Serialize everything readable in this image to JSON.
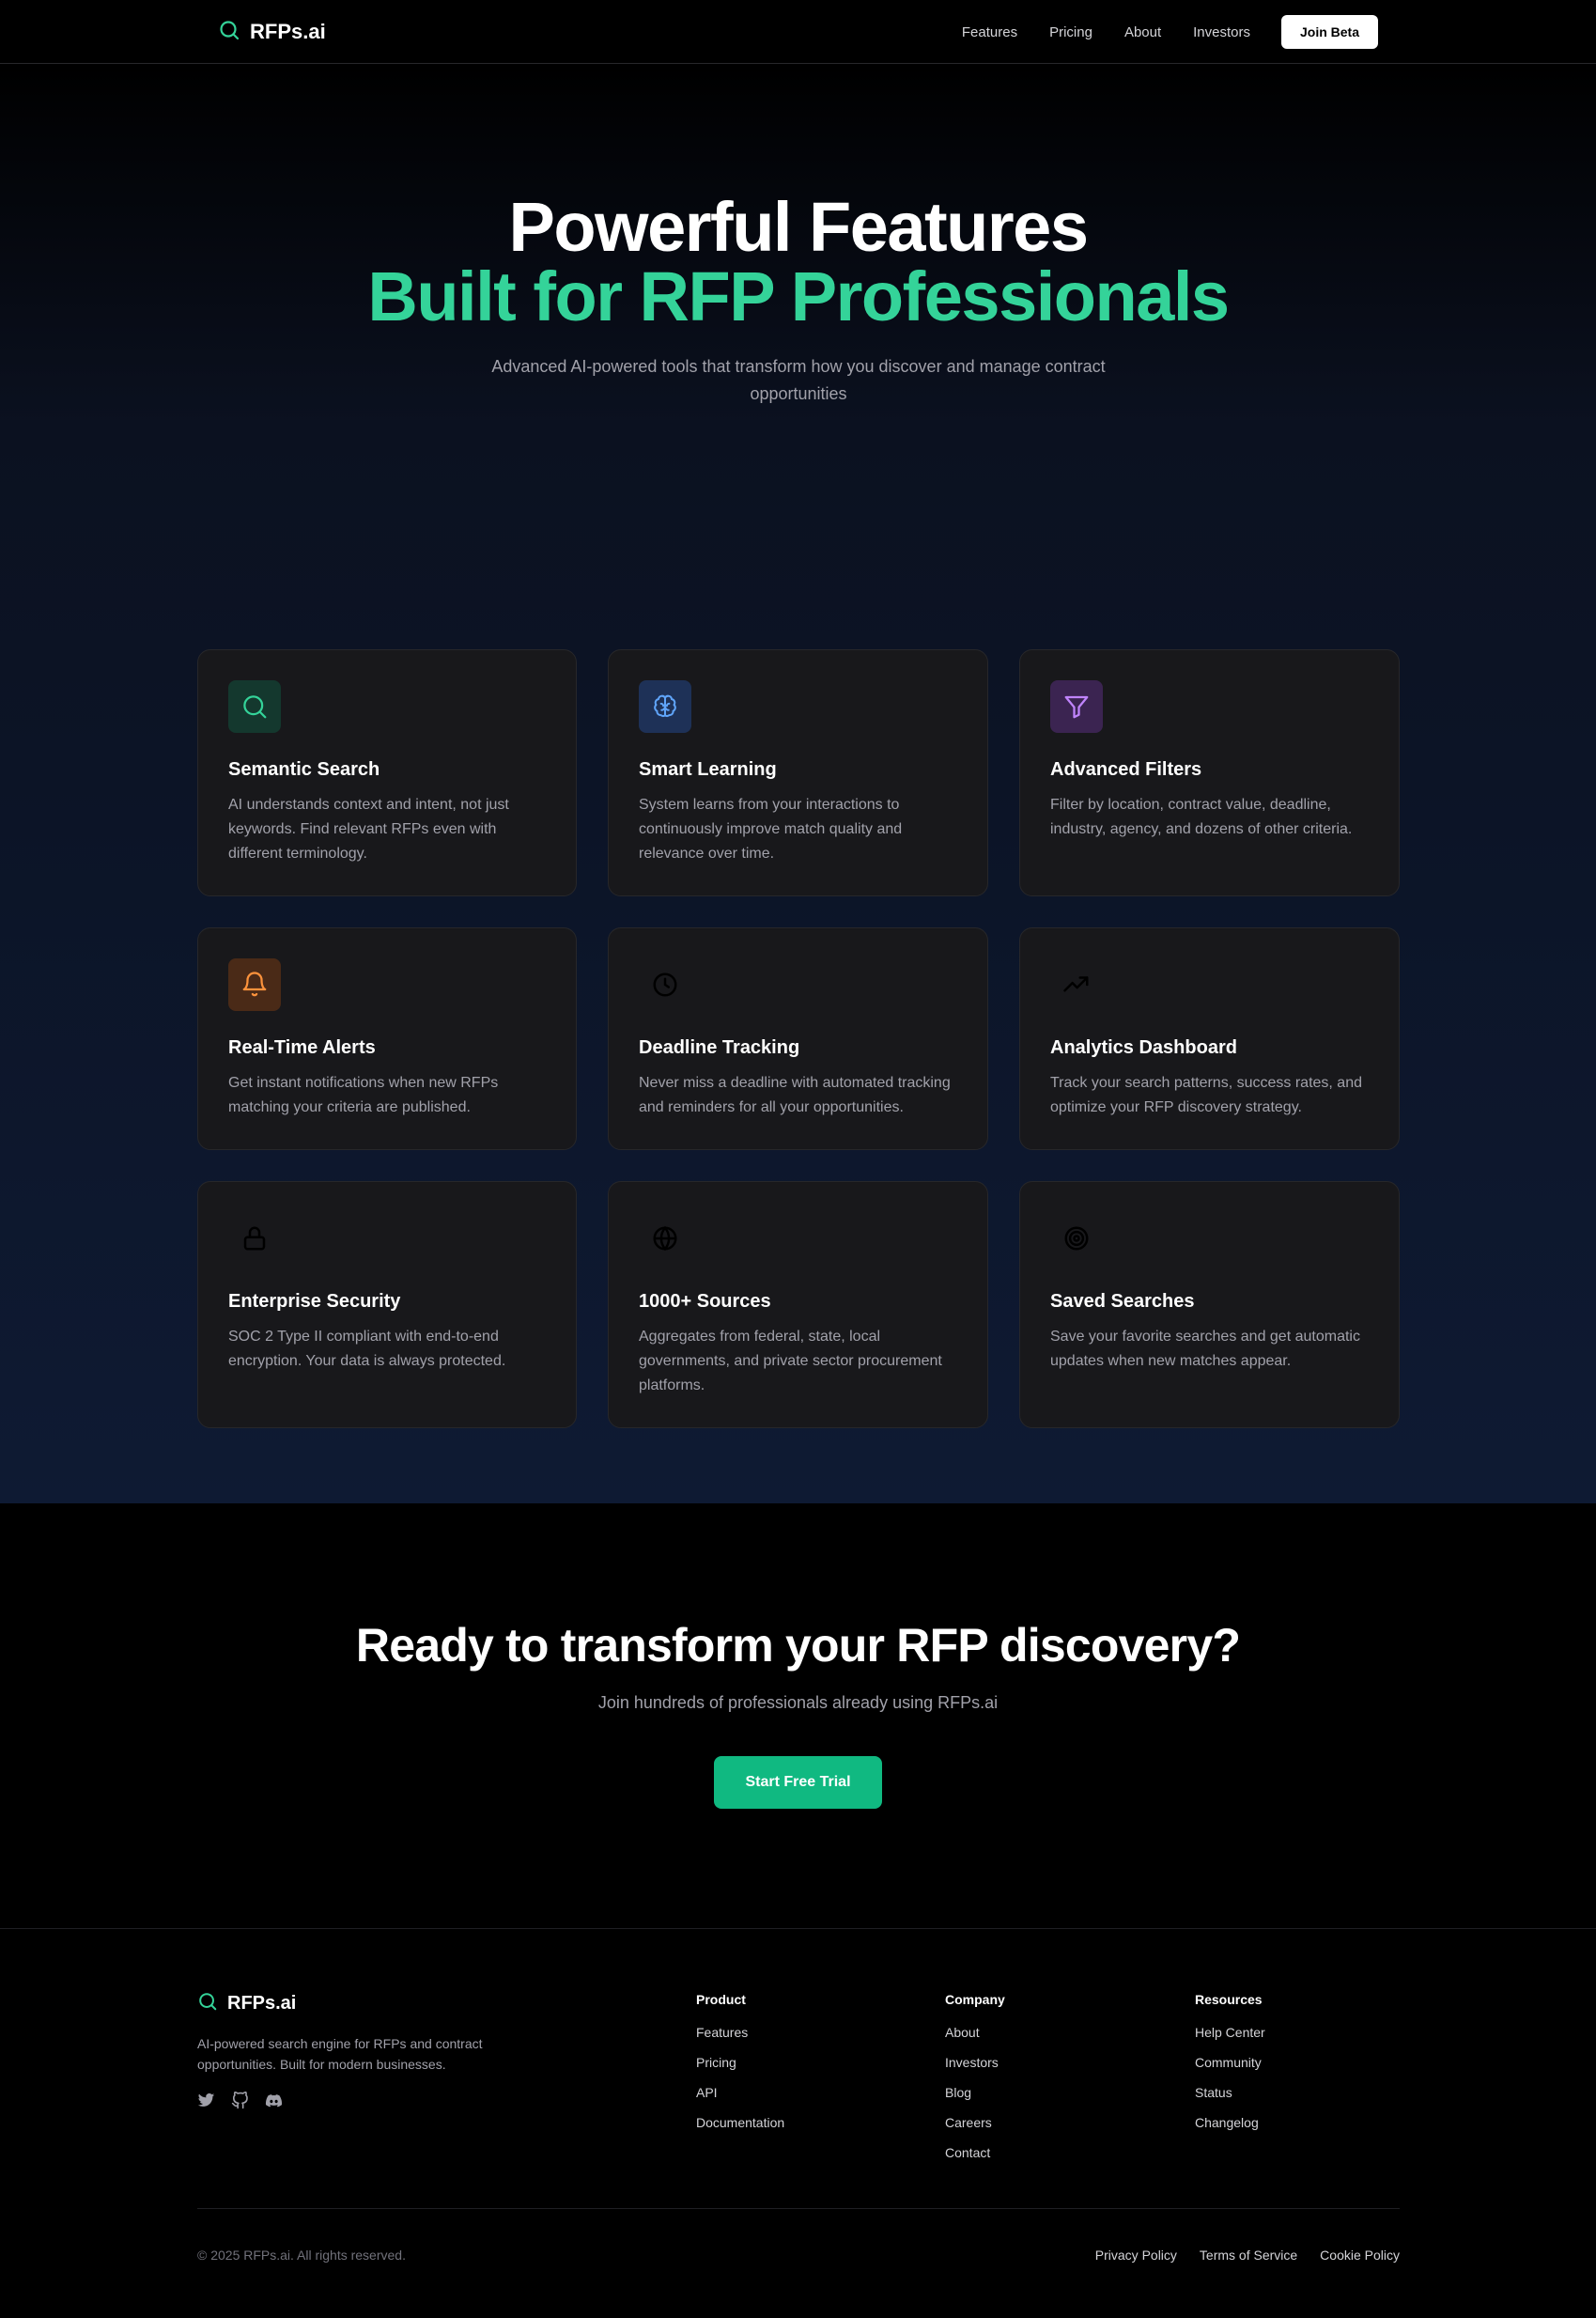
{
  "nav": {
    "brand": "RFPs.ai",
    "links": [
      "Features",
      "Pricing",
      "About",
      "Investors"
    ],
    "cta": "Join Beta"
  },
  "hero": {
    "title_line1": "Powerful Features",
    "title_line2": "Built for RFP Professionals",
    "subtitle": "Advanced AI-powered tools that transform how you discover and manage contract opportunities"
  },
  "features": [
    {
      "title": "Semantic Search",
      "desc": "AI understands context and intent, not just keywords. Find relevant RFPs even with different terminology.",
      "icon": "search-icon"
    },
    {
      "title": "Smart Learning",
      "desc": "System learns from your interactions to continuously improve match quality and relevance over time.",
      "icon": "brain-icon"
    },
    {
      "title": "Advanced Filters",
      "desc": "Filter by location, contract value, deadline, industry, agency, and dozens of other criteria.",
      "icon": "filter-icon"
    },
    {
      "title": "Real-Time Alerts",
      "desc": "Get instant notifications when new RFPs matching your criteria are published.",
      "icon": "bell-icon"
    },
    {
      "title": "Deadline Tracking",
      "desc": "Never miss a deadline with automated tracking and reminders for all your opportunities.",
      "icon": "clock-icon"
    },
    {
      "title": "Analytics Dashboard",
      "desc": "Track your search patterns, success rates, and optimize your RFP discovery strategy.",
      "icon": "trending-up-icon"
    },
    {
      "title": "Enterprise Security",
      "desc": "SOC 2 Type II compliant with end-to-end encryption. Your data is always protected.",
      "icon": "lock-icon"
    },
    {
      "title": "1000+ Sources",
      "desc": "Aggregates from federal, state, local governments, and private sector procurement platforms.",
      "icon": "globe-icon"
    },
    {
      "title": "Saved Searches",
      "desc": "Save your favorite searches and get automatic updates when new matches appear.",
      "icon": "target-icon"
    }
  ],
  "colors": {
    "accent_green": "#34d399",
    "button_green": "#10b981",
    "search_bg": "#14382e",
    "brain_bg": "#1e3157",
    "filter_bg": "#3b2451",
    "bell_bg": "#4a2a17"
  },
  "cta": {
    "title": "Ready to transform your RFP discovery?",
    "subtitle": "Join hundreds of professionals already using RFPs.ai",
    "button": "Start Free Trial"
  },
  "footer": {
    "brand": "RFPs.ai",
    "description": "AI-powered search engine for RFPs and contract opportunities. Built for modern businesses.",
    "socials": [
      "twitter-icon",
      "github-icon",
      "discord-icon"
    ],
    "columns": [
      {
        "title": "Product",
        "links": [
          "Features",
          "Pricing",
          "API",
          "Documentation"
        ]
      },
      {
        "title": "Company",
        "links": [
          "About",
          "Investors",
          "Blog",
          "Careers",
          "Contact"
        ]
      },
      {
        "title": "Resources",
        "links": [
          "Help Center",
          "Community",
          "Status",
          "Changelog"
        ]
      }
    ],
    "copyright": "© 2025 RFPs.ai. All rights reserved.",
    "legal": [
      "Privacy Policy",
      "Terms of Service",
      "Cookie Policy"
    ]
  }
}
